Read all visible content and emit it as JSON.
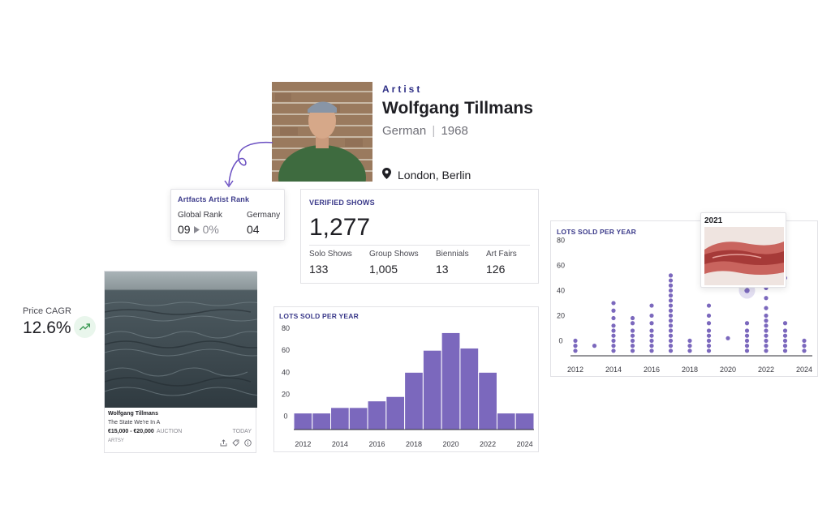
{
  "artist": {
    "eyebrow": "Artist",
    "name": "Wolfgang Tillmans",
    "nationality": "German",
    "separator": "|",
    "birth_year": "1968",
    "location": "London, Berlin"
  },
  "rank_card": {
    "title": "Artfacts Artist Rank",
    "global_label": "Global Rank",
    "global_value": "09",
    "global_change": "0%",
    "country_label": "Germany",
    "country_value": "04"
  },
  "verified_shows": {
    "title": "VERIFIED SHOWS",
    "total": "1,277",
    "stats": [
      {
        "label": "Solo Shows",
        "value": "133"
      },
      {
        "label": "Group Shows",
        "value": "1,005"
      },
      {
        "label": "Biennials",
        "value": "13"
      },
      {
        "label": "Art Fairs",
        "value": "126"
      }
    ]
  },
  "price_cagr": {
    "label": "Price CAGR",
    "value": "12.6%",
    "icon": "trending-up-icon"
  },
  "artwork": {
    "artist": "Wolfgang Tillmans",
    "title": "The State We're In A",
    "price": "€15,000 - €20,000",
    "type": "AUCTION",
    "date": "TODAY",
    "source": "ARTSY"
  },
  "colors": {
    "accent": "#7b68bd",
    "title_blue": "#3b3a8a",
    "positive": "#3d9a55"
  },
  "chart_data": [
    {
      "type": "bar",
      "title": "LOTS SOLD PER YEAR",
      "x": [
        2012,
        2013,
        2014,
        2015,
        2016,
        2017,
        2018,
        2019,
        2020,
        2021,
        2022,
        2023,
        2024
      ],
      "values": [
        3,
        3,
        8,
        8,
        14,
        18,
        40,
        60,
        76,
        62,
        40,
        3,
        3
      ],
      "x_ticks": [
        "2012",
        "2014",
        "2016",
        "2018",
        "2020",
        "2022",
        "2024"
      ],
      "y_ticks": [
        "0",
        "20",
        "40",
        "60",
        "80"
      ],
      "y_tick_values": [
        0,
        20,
        40,
        60,
        80
      ],
      "ylim": [
        -12,
        80
      ]
    },
    {
      "type": "scatter",
      "title": "LOTS SOLD PER YEAR",
      "x_ticks": [
        "2012",
        "2014",
        "2016",
        "2018",
        "2020",
        "2022",
        "2024"
      ],
      "y_ticks": [
        "0",
        "20",
        "40",
        "60",
        "80"
      ],
      "y_tick_values": [
        0,
        20,
        40,
        60,
        80
      ],
      "ylim": [
        -12,
        90
      ],
      "series": [
        {
          "x": 2012,
          "y": [
            -8,
            -4,
            0
          ]
        },
        {
          "x": 2013,
          "y": [
            -4
          ]
        },
        {
          "x": 2014,
          "y": [
            -8,
            -4,
            0,
            4,
            8,
            12,
            18,
            24,
            30
          ]
        },
        {
          "x": 2015,
          "y": [
            -8,
            -4,
            0,
            4,
            8,
            14,
            18
          ]
        },
        {
          "x": 2016,
          "y": [
            -8,
            -4,
            0,
            4,
            8,
            14,
            20,
            28
          ]
        },
        {
          "x": 2017,
          "y": [
            -8,
            -4,
            0,
            4,
            8,
            12,
            16,
            20,
            24,
            28,
            32,
            36,
            40,
            44,
            48,
            52
          ]
        },
        {
          "x": 2018,
          "y": [
            -8,
            -4,
            0
          ]
        },
        {
          "x": 2019,
          "y": [
            -8,
            -4,
            0,
            4,
            8,
            14,
            20,
            28
          ]
        },
        {
          "x": 2020,
          "y": [
            2
          ]
        },
        {
          "x": 2021,
          "y": [
            -8,
            -4,
            0,
            4,
            8,
            14
          ]
        },
        {
          "x": 2022,
          "y": [
            -8,
            -4,
            0,
            4,
            8,
            12,
            16,
            20,
            26,
            34,
            42,
            50
          ]
        },
        {
          "x": 2023,
          "y": [
            -8,
            -4,
            0,
            4,
            8,
            14,
            50
          ]
        },
        {
          "x": 2024,
          "y": [
            -8,
            -4,
            0
          ]
        }
      ],
      "highlight": {
        "x": 2021,
        "y": 40,
        "label": "2021"
      }
    }
  ]
}
